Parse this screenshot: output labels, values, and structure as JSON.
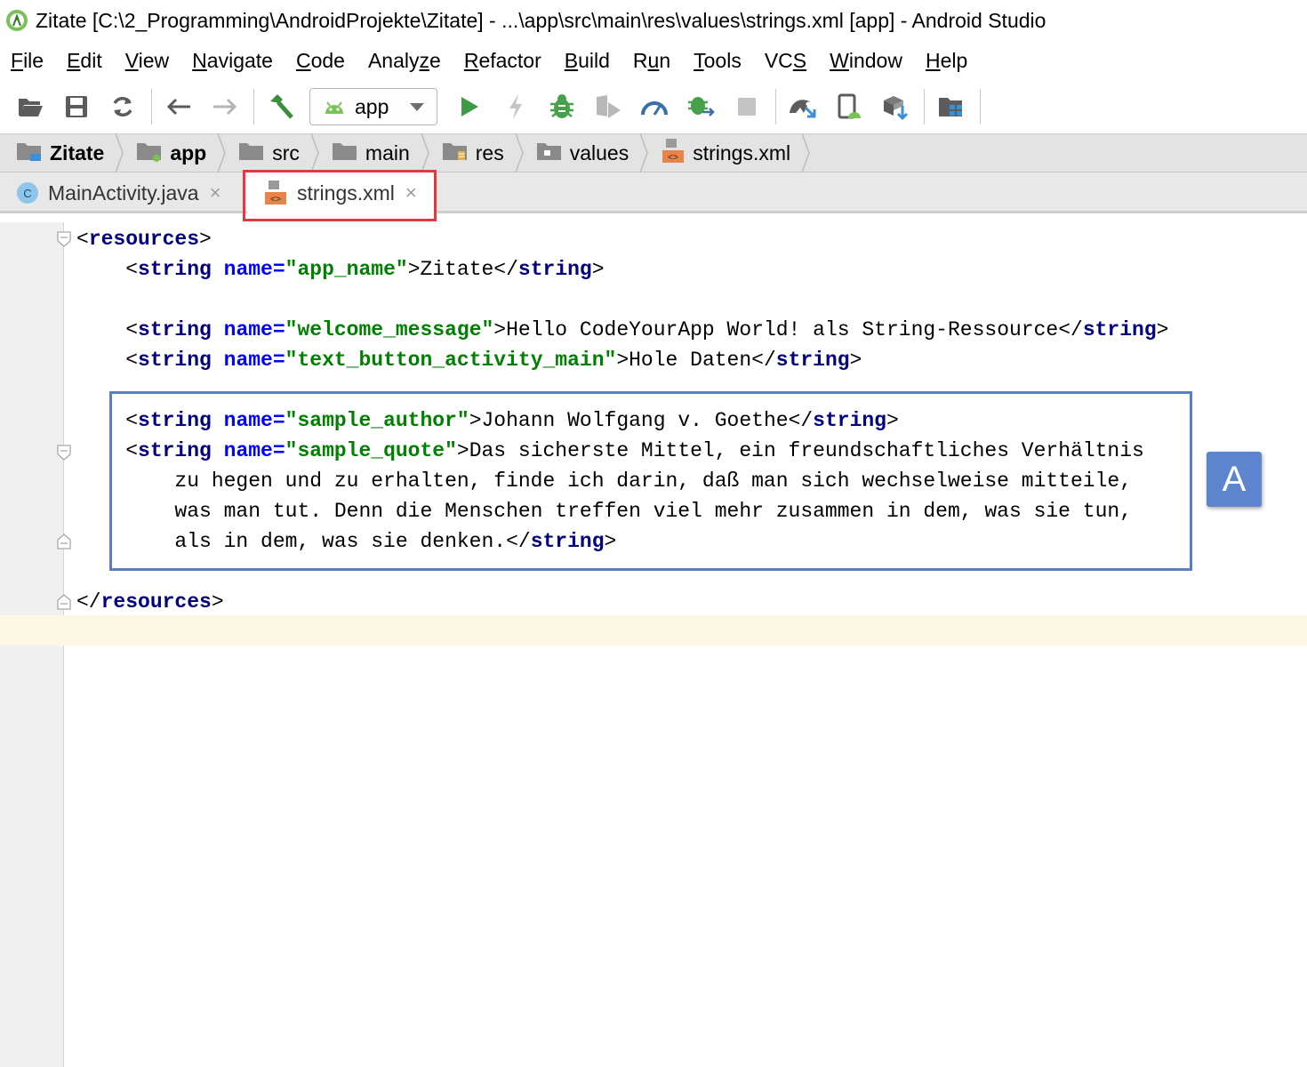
{
  "window": {
    "title": "Zitate [C:\\2_Programming\\AndroidProjekte\\Zitate] - ...\\app\\src\\main\\res\\values\\strings.xml [app] - Android Studio"
  },
  "menu": [
    {
      "pre": "",
      "u": "F",
      "post": "ile"
    },
    {
      "pre": "",
      "u": "E",
      "post": "dit"
    },
    {
      "pre": "",
      "u": "V",
      "post": "iew"
    },
    {
      "pre": "",
      "u": "N",
      "post": "avigate"
    },
    {
      "pre": "",
      "u": "C",
      "post": "ode"
    },
    {
      "pre": "Analy",
      "u": "z",
      "post": "e"
    },
    {
      "pre": "",
      "u": "R",
      "post": "efactor"
    },
    {
      "pre": "",
      "u": "B",
      "post": "uild"
    },
    {
      "pre": "R",
      "u": "u",
      "post": "n"
    },
    {
      "pre": "",
      "u": "T",
      "post": "ools"
    },
    {
      "pre": "VC",
      "u": "S",
      "post": ""
    },
    {
      "pre": "",
      "u": "W",
      "post": "indow"
    },
    {
      "pre": "",
      "u": "H",
      "post": "elp"
    }
  ],
  "toolbar": {
    "run_config": "app"
  },
  "breadcrumb": [
    "Zitate",
    "app",
    "src",
    "main",
    "res",
    "values",
    "strings.xml"
  ],
  "tabs": [
    {
      "label": "MainActivity.java",
      "close": "×"
    },
    {
      "label": "strings.xml",
      "close": "×"
    }
  ],
  "editor": {
    "lines": [
      [
        {
          "c": "p",
          "t": "<"
        },
        {
          "c": "tag",
          "t": "resources"
        },
        {
          "c": "p",
          "t": ">"
        }
      ],
      [
        {
          "c": "p",
          "t": "    <"
        },
        {
          "c": "tag",
          "t": "string "
        },
        {
          "c": "attr",
          "t": "name="
        },
        {
          "c": "val",
          "t": "\"app_name\""
        },
        {
          "c": "p",
          "t": ">Zitate</"
        },
        {
          "c": "tag",
          "t": "string"
        },
        {
          "c": "p",
          "t": ">"
        }
      ],
      [],
      [
        {
          "c": "p",
          "t": "    <"
        },
        {
          "c": "tag",
          "t": "string "
        },
        {
          "c": "attr",
          "t": "name="
        },
        {
          "c": "val",
          "t": "\"welcome_message\""
        },
        {
          "c": "p",
          "t": ">Hello CodeYourApp World! als String-Ressource</"
        },
        {
          "c": "tag",
          "t": "string"
        },
        {
          "c": "p",
          "t": ">"
        }
      ],
      [
        {
          "c": "p",
          "t": "    <"
        },
        {
          "c": "tag",
          "t": "string "
        },
        {
          "c": "attr",
          "t": "name="
        },
        {
          "c": "val",
          "t": "\"text_button_activity_main\""
        },
        {
          "c": "p",
          "t": ">Hole Daten</"
        },
        {
          "c": "tag",
          "t": "string"
        },
        {
          "c": "p",
          "t": ">"
        }
      ],
      [],
      [
        {
          "c": "p",
          "t": "    <"
        },
        {
          "c": "tag",
          "t": "string "
        },
        {
          "c": "attr",
          "t": "name="
        },
        {
          "c": "val",
          "t": "\"sample_author\""
        },
        {
          "c": "p",
          "t": ">Johann Wolfgang v. Goethe</"
        },
        {
          "c": "tag",
          "t": "string"
        },
        {
          "c": "p",
          "t": ">"
        }
      ],
      [
        {
          "c": "p",
          "t": "    <"
        },
        {
          "c": "tag",
          "t": "string "
        },
        {
          "c": "attr",
          "t": "name="
        },
        {
          "c": "val",
          "t": "\"sample_quote\""
        },
        {
          "c": "p",
          "t": ">Das sicherste Mittel, ein freundschaftliches Verhältnis"
        }
      ],
      [
        {
          "c": "p",
          "t": "        zu hegen und zu erhalten, finde ich darin, daß man sich wechselweise mitteile,"
        }
      ],
      [
        {
          "c": "p",
          "t": "        was man tut. Denn die Menschen treffen viel mehr zusammen in dem, was sie tun,"
        }
      ],
      [
        {
          "c": "p",
          "t": "        als in dem, was sie denken.</"
        },
        {
          "c": "tag",
          "t": "string"
        },
        {
          "c": "p",
          "t": ">"
        }
      ],
      [],
      [
        {
          "c": "p",
          "t": "</"
        },
        {
          "c": "tag",
          "t": "resources"
        },
        {
          "c": "p",
          "t": ">"
        }
      ]
    ]
  },
  "annotation": {
    "badge": "A"
  },
  "colors": {
    "tab_highlight": "#e0393e",
    "block_highlight": "#5b7fc7",
    "badge_bg": "#5d84cf",
    "xml_tag": "#000080",
    "xml_attr": "#0000ff",
    "xml_value": "#008000",
    "android_green": "#78c257"
  },
  "icons": [
    "android-studio-logo-icon",
    "open-folder-icon",
    "save-icon",
    "sync-icon",
    "back-arrow-icon",
    "forward-arrow-icon",
    "build-hammer-icon",
    "android-icon",
    "run-icon",
    "apply-changes-icon",
    "debug-icon",
    "attach-debugger-icon",
    "profile-icon",
    "attach-process-icon",
    "stop-icon",
    "gradle-sync-icon",
    "avd-manager-icon",
    "sdk-manager-icon",
    "project-structure-icon"
  ]
}
